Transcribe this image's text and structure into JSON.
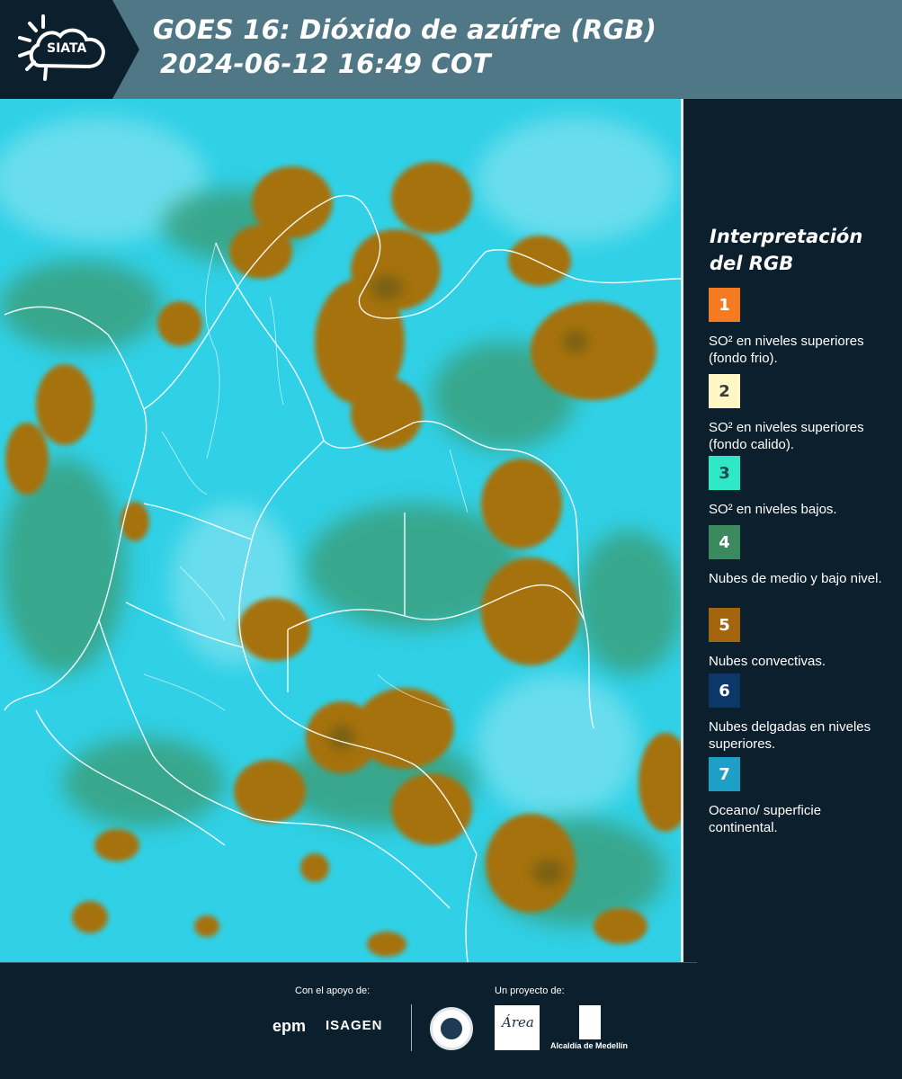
{
  "header": {
    "logo_text": "SIATA",
    "title_line1": "GOES 16: Dióxido de azúfre (RGB)",
    "title_line2": "2024-06-12 16:49 COT"
  },
  "legend": {
    "title": "Interpretación del RGB",
    "items": [
      {
        "number": "1",
        "color": "#f47b20",
        "number_color": "#ffffff",
        "text": "SO² en niveles superiores (fondo frio)."
      },
      {
        "number": "2",
        "color": "#fff7c4",
        "number_color": "#3a3a3a",
        "text": "SO² en niveles superiores (fondo calido)."
      },
      {
        "number": "3",
        "color": "#2ee8c8",
        "number_color": "#1a4d4a",
        "text": "SO² en niveles bajos."
      },
      {
        "number": "4",
        "color": "#3a8a5e",
        "number_color": "#ffffff",
        "text": "Nubes de medio y bajo nivel."
      },
      {
        "number": "5",
        "color": "#a5650e",
        "number_color": "#ffffff",
        "text": "Nubes convectivas."
      },
      {
        "number": "6",
        "color": "#0d3768",
        "number_color": "#ffffff",
        "text": "Nubes delgadas en niveles superiores."
      },
      {
        "number": "7",
        "color": "#1d9fc8",
        "number_color": "#ffffff",
        "text": "Oceano/ superficie continental."
      }
    ]
  },
  "footer": {
    "support_label": "Con el apoyo de:",
    "project_label": "Un proyecto de:",
    "sponsor_epm": "epm",
    "sponsor_isagen": "ISAGEN",
    "partner_area": "Área",
    "partner_alcaldia": "Alcaldía de Medellín"
  },
  "colors": {
    "header_bg": "#4f7785",
    "panel_bg": "#0c1f2d",
    "cyan_surface": "#2ecfe6",
    "convective_brown": "#a5720f",
    "mid_level_green": "#3a8a5e"
  }
}
